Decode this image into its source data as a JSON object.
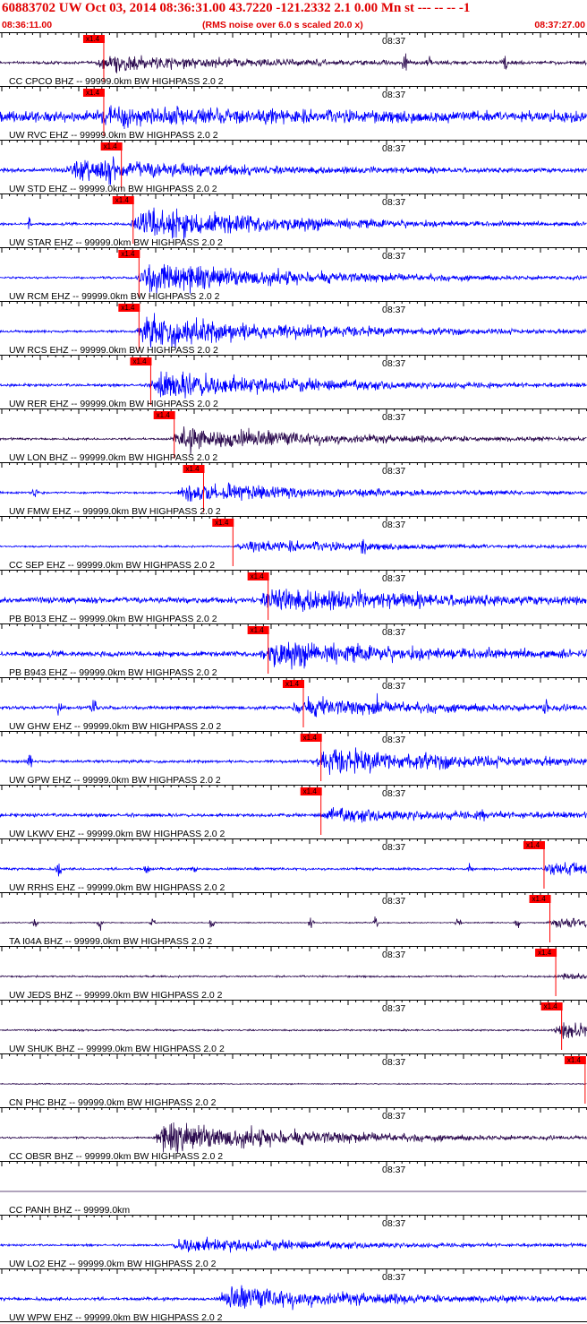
{
  "header": {
    "title": "60883702 UW Oct 03, 2014 08:36:31.00   43.7220 -121.2332  2.1 0.00 Mn st --- -- --   -1",
    "start_time": "08:36:11.00",
    "note": "(RMS noise over 6.0 s scaled 20.0 x)",
    "end_time": "08:37:27.00"
  },
  "minute_label": "08:37",
  "pick_label": "x1.4",
  "colors": {
    "blue": "#0000ff",
    "dark": "#2b0a4e",
    "pick": "#ff0000",
    "header": "#e00000"
  },
  "traces": [
    {
      "label": "CC CPCO BHZ -- 99999.0km BW  HIGHPASS  2.0  2",
      "color": "dark",
      "pick": 0.16,
      "onset": 0.16,
      "noise": 0.08,
      "burst": 0.45,
      "spikes": [
        0.69,
        0.73,
        0.86
      ]
    },
    {
      "label": "UW RVC EHZ -- 99999.0km BW  HIGHPASS  2.0  2",
      "color": "blue",
      "pick": 0.16,
      "onset": 0.16,
      "noise": 0.3,
      "burst": 0.4,
      "spikes": []
    },
    {
      "label": "UW STD EHZ -- 99999.0km BW  HIGHPASS  2.0  2",
      "color": "blue",
      "pick": 0.19,
      "onset": 0.11,
      "noise": 0.12,
      "burst": 0.6,
      "spikes": [
        0.19
      ]
    },
    {
      "label": "UW STAR EHZ -- 99999.0km BW  HIGHPASS  2.0  2",
      "color": "blue",
      "pick": 0.21,
      "onset": 0.22,
      "noise": 0.07,
      "burst": 1.0,
      "spikes": [
        0.05
      ]
    },
    {
      "label": "UW RCM EHZ -- 99999.0km BW  HIGHPASS  2.0  2",
      "color": "blue",
      "pick": 0.22,
      "onset": 0.23,
      "noise": 0.06,
      "burst": 1.0,
      "spikes": []
    },
    {
      "label": "UW RCS EHZ -- 99999.0km BW  HIGHPASS  2.0  2",
      "color": "blue",
      "pick": 0.22,
      "onset": 0.23,
      "noise": 0.07,
      "burst": 1.0,
      "spikes": []
    },
    {
      "label": "UW RER EHZ -- 99999.0km BW  HIGHPASS  2.0  2",
      "color": "blue",
      "pick": 0.24,
      "onset": 0.25,
      "noise": 0.08,
      "burst": 0.9,
      "spikes": []
    },
    {
      "label": "UW LON BHZ -- 99999.0km BW  HIGHPASS  2.0  2",
      "color": "dark",
      "pick": 0.28,
      "onset": 0.29,
      "noise": 0.06,
      "burst": 0.75,
      "spikes": []
    },
    {
      "label": "UW FMW EHZ -- 99999.0km BW  HIGHPASS  2.0  2",
      "color": "blue",
      "pick": 0.33,
      "onset": 0.3,
      "noise": 0.06,
      "burst": 0.6,
      "spikes": [
        0.06
      ]
    },
    {
      "label": "CC SEP EHZ -- 99999.0km BW  HIGHPASS  2.0  2",
      "color": "blue",
      "pick": 0.38,
      "onset": 0.4,
      "noise": 0.05,
      "burst": 0.4,
      "spikes": [
        0.62
      ]
    },
    {
      "label": "PB B013 EHZ -- 99999.0km BW  HIGHPASS  2.0  2",
      "color": "blue",
      "pick": 0.44,
      "onset": 0.44,
      "noise": 0.17,
      "burst": 0.75,
      "spikes": []
    },
    {
      "label": "PB B943 EHZ -- 99999.0km BW  HIGHPASS  2.0  2",
      "color": "blue",
      "pick": 0.44,
      "onset": 0.44,
      "noise": 0.15,
      "burst": 0.75,
      "spikes": []
    },
    {
      "label": "UW GHW EHZ -- 99999.0km BW  HIGHPASS  2.0  2",
      "color": "blue",
      "pick": 0.5,
      "onset": 0.49,
      "noise": 0.1,
      "burst": 0.5,
      "spikes": [
        0.1,
        0.16,
        0.55,
        0.64,
        0.93
      ]
    },
    {
      "label": "UW GPW EHZ -- 99999.0km BW  HIGHPASS  2.0  2",
      "color": "blue",
      "pick": 0.53,
      "onset": 0.53,
      "noise": 0.08,
      "burst": 0.8,
      "spikes": [
        0.05
      ]
    },
    {
      "label": "UW LKWV EHZ -- 99999.0km BW  HIGHPASS  2.0  2",
      "color": "blue",
      "pick": 0.53,
      "onset": 0.54,
      "noise": 0.1,
      "burst": 0.4,
      "spikes": [
        0.82
      ]
    },
    {
      "label": "UW RRHS EHZ -- 99999.0km BW  HIGHPASS  2.0  2",
      "color": "blue",
      "pick": 0.91,
      "onset": 0.92,
      "noise": 0.07,
      "burst": 0.35,
      "spikes": [
        0.1,
        0.25,
        0.33,
        0.8
      ]
    },
    {
      "label": "TA I04A BHZ -- 99999.0km BW  HIGHPASS  2.0  2",
      "color": "dark",
      "pick": 0.92,
      "onset": 0.93,
      "noise": 0.03,
      "burst": 0.35,
      "spikes": [
        0.06,
        0.17,
        0.26,
        0.36,
        0.53,
        0.64,
        0.78,
        0.88
      ]
    },
    {
      "label": "UW JEDS BHZ -- 99999.0km BW  HIGHPASS  2.0  2",
      "color": "dark",
      "pick": 0.93,
      "onset": 0.94,
      "noise": 0.05,
      "burst": 0.15,
      "spikes": []
    },
    {
      "label": "UW SHUK BHZ -- 99999.0km BW  HIGHPASS  2.0  2",
      "color": "dark",
      "pick": 0.94,
      "onset": 0.94,
      "noise": 0.05,
      "burst": 0.6,
      "spikes": []
    },
    {
      "label": "CN PHC BHZ -- 99999.0km BW  HIGHPASS  2.0  2",
      "color": "dark",
      "pick": 0.98,
      "onset": 1.2,
      "noise": 0.03,
      "burst": 0,
      "spikes": []
    },
    {
      "label": "CC OBSR BHZ -- 99999.0km BW  HIGHPASS  2.0  2",
      "color": "dark",
      "pick": null,
      "onset": 0.26,
      "noise": 0.05,
      "burst": 1.0,
      "spikes": []
    },
    {
      "label": "CC PANH BHZ -- 99999.0km",
      "color": "dark",
      "pick": null,
      "onset": 1.2,
      "noise": 0,
      "burst": 0,
      "spikes": []
    },
    {
      "label": "UW LO2 EHZ -- 99999.0km BW  HIGHPASS  2.0  2",
      "color": "blue",
      "pick": null,
      "onset": 0.29,
      "noise": 0.06,
      "burst": 0.5,
      "spikes": []
    },
    {
      "label": "UW WPW EHZ -- 99999.0km BW  HIGHPASS  2.0  2",
      "color": "blue",
      "pick": null,
      "onset": 0.37,
      "noise": 0.09,
      "burst": 0.7,
      "spikes": []
    }
  ]
}
